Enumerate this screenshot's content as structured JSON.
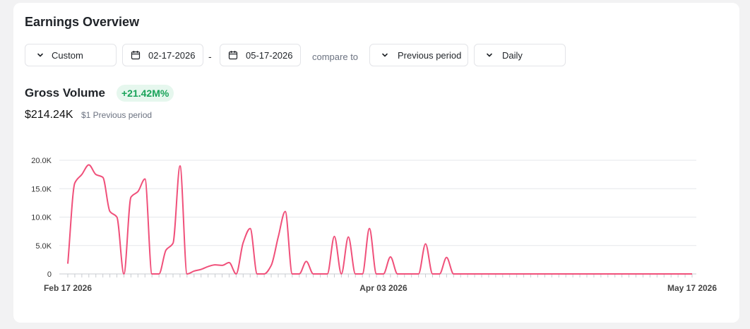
{
  "header": {
    "title": "Earnings Overview"
  },
  "controls": {
    "range_label": "Custom",
    "start_date": "02-17-2026",
    "separator": "-",
    "end_date": "05-17-2026",
    "compare_label": "compare to",
    "compare_value": "Previous period",
    "interval": "Daily"
  },
  "metric": {
    "name": "Gross Volume",
    "change": "+21.42M%",
    "value": "$214.24K",
    "previous": "$1 Previous period"
  },
  "colors": {
    "line": "#f0507a",
    "badge_bg": "#e6f7ee",
    "badge_text": "#1aa35a"
  },
  "chart_data": {
    "type": "line",
    "title": "",
    "xlabel": "",
    "ylabel": "",
    "ylim": [
      0,
      20000
    ],
    "yticks": [
      {
        "value": 0,
        "label": "0"
      },
      {
        "value": 5000,
        "label": "5.0K"
      },
      {
        "value": 10000,
        "label": "10.0K"
      },
      {
        "value": 15000,
        "label": "15.0K"
      },
      {
        "value": 20000,
        "label": "20.0K"
      }
    ],
    "xticks": [
      {
        "index": 0,
        "label": "Feb 17 2026"
      },
      {
        "index": 45,
        "label": "Apr 03 2026"
      },
      {
        "index": 89,
        "label": "May 17 2026"
      }
    ],
    "grid": true,
    "series": [
      {
        "values": [
          1800,
          16000,
          17500,
          19200,
          17500,
          17000,
          11000,
          10000,
          0,
          13500,
          14500,
          16700,
          0,
          0,
          4200,
          5400,
          19000,
          0,
          500,
          800,
          1300,
          1600,
          1500,
          2000,
          0,
          5500,
          8000,
          0,
          0,
          1500,
          6500,
          11000,
          0,
          0,
          2200,
          0,
          0,
          0,
          6600,
          0,
          6500,
          0,
          0,
          8000,
          0,
          0,
          3000,
          0,
          0,
          0,
          0,
          5300,
          0,
          0,
          2900,
          0,
          0,
          0,
          0,
          0,
          0,
          0,
          0,
          0,
          0,
          0,
          0,
          0,
          0,
          0,
          0,
          0,
          0,
          0,
          0,
          0,
          0,
          0,
          0,
          0,
          0,
          0,
          0,
          0,
          0,
          0,
          0,
          0,
          0,
          0
        ]
      }
    ]
  }
}
